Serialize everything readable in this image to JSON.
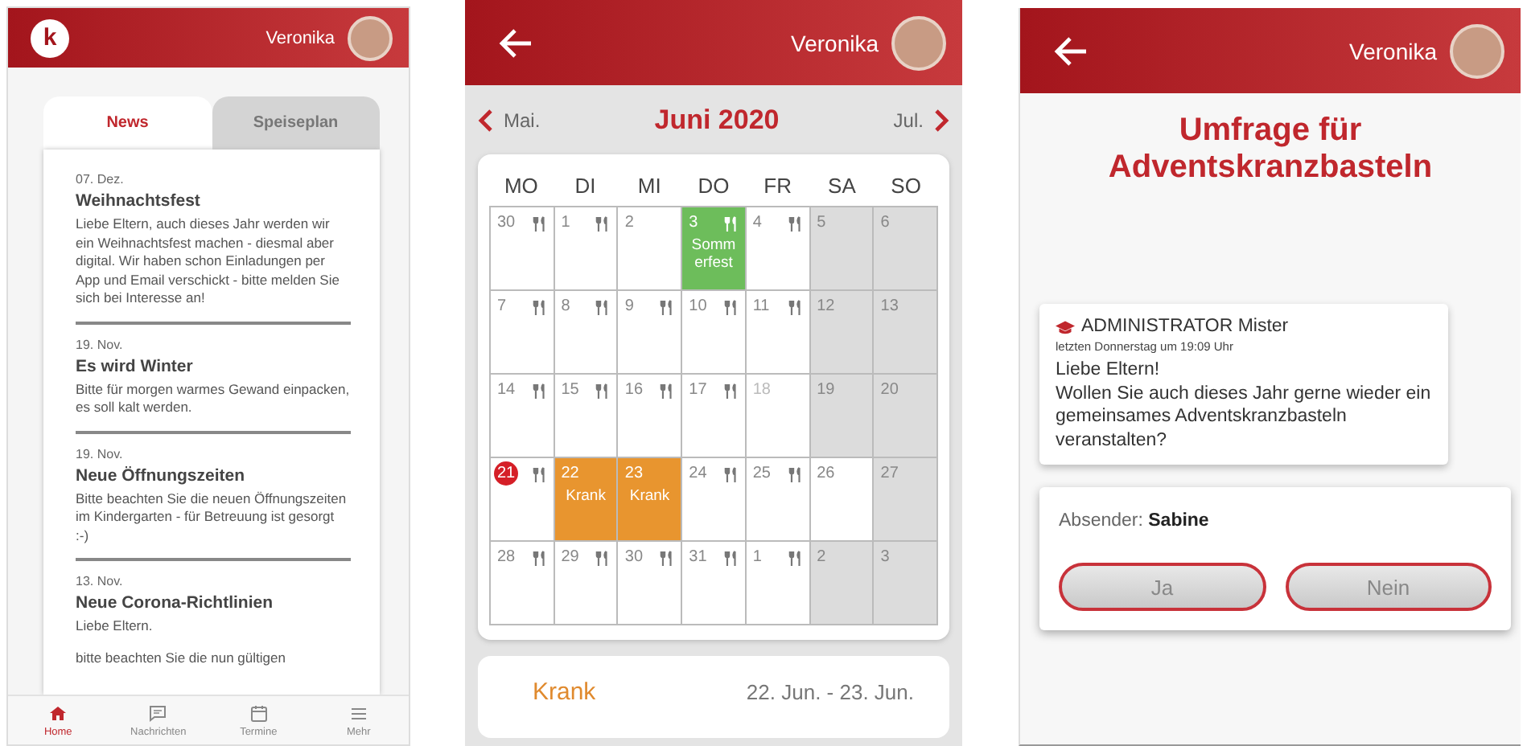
{
  "news_screen": {
    "header": {
      "logo_letter": "k",
      "user": "Veronika"
    },
    "tabs": [
      {
        "label": "News",
        "selected": true
      },
      {
        "label": "Speiseplan",
        "selected": false
      }
    ],
    "news": [
      {
        "date": "07. Dez.",
        "title": "Weihnachtsfest",
        "paragraphs": [
          "Liebe Eltern, auch dieses Jahr werden wir ein Weihnachtsfest machen - diesmal aber digital. Wir haben schon Einladungen per App und Email verschickt - bitte melden Sie sich bei Interesse an!"
        ]
      },
      {
        "date": "19. Nov.",
        "title": "Es wird Winter",
        "paragraphs": [
          "Bitte für morgen warmes Gewand einpacken, es soll kalt werden."
        ]
      },
      {
        "date": "19. Nov.",
        "title": "Neue Öffnungszeiten",
        "paragraphs": [
          "Bitte beachten Sie die neuen Öffnungszeiten im Kindergarten - für Betreuung ist gesorgt :-)"
        ]
      },
      {
        "date": "13. Nov.",
        "title": "Neue Corona-Richtlinien",
        "paragraphs": [
          "Liebe Eltern.",
          "bitte beachten Sie die nun gültigen"
        ]
      }
    ],
    "nav": [
      {
        "label": "Home",
        "kind": "home",
        "selected": true
      },
      {
        "label": "Nachrichten",
        "kind": "chat",
        "selected": false
      },
      {
        "label": "Termine",
        "kind": "calendar",
        "selected": false
      },
      {
        "label": "Mehr",
        "kind": "menu",
        "selected": false
      }
    ]
  },
  "calendar_screen": {
    "header": {
      "user": "Veronika"
    },
    "month_nav": {
      "previous": "Mai.",
      "title": "Juni 2020",
      "next": "Jul."
    },
    "weekdays": [
      "MO",
      "DI",
      "MI",
      "DO",
      "FR",
      "SA",
      "SO"
    ],
    "weeks": [
      [
        {
          "day": "30",
          "kind": "workday",
          "meal": true,
          "today": false,
          "muted": false
        },
        {
          "day": "1",
          "kind": "workday",
          "meal": true,
          "today": false,
          "muted": false
        },
        {
          "day": "2",
          "kind": "workday",
          "meal": false,
          "today": false,
          "muted": false
        },
        {
          "day": "3",
          "kind": "event",
          "meal": true,
          "today": false,
          "muted": false,
          "event": "Sommerfest",
          "color": "#6dbd5b"
        },
        {
          "day": "4",
          "kind": "workday",
          "meal": true,
          "today": false,
          "muted": false
        },
        {
          "day": "5",
          "kind": "weekend",
          "meal": false,
          "today": false,
          "muted": false
        },
        {
          "day": "6",
          "kind": "weekend",
          "meal": false,
          "today": false,
          "muted": false
        }
      ],
      [
        {
          "day": "7",
          "kind": "workday",
          "meal": true,
          "today": false,
          "muted": false
        },
        {
          "day": "8",
          "kind": "workday",
          "meal": true,
          "today": false,
          "muted": false
        },
        {
          "day": "9",
          "kind": "workday",
          "meal": true,
          "today": false,
          "muted": false
        },
        {
          "day": "10",
          "kind": "workday",
          "meal": true,
          "today": false,
          "muted": false
        },
        {
          "day": "11",
          "kind": "workday",
          "meal": true,
          "today": false,
          "muted": false
        },
        {
          "day": "12",
          "kind": "weekend",
          "meal": false,
          "today": false,
          "muted": false
        },
        {
          "day": "13",
          "kind": "weekend",
          "meal": false,
          "today": false,
          "muted": false
        }
      ],
      [
        {
          "day": "14",
          "kind": "workday",
          "meal": true,
          "today": false,
          "muted": false
        },
        {
          "day": "15",
          "kind": "workday",
          "meal": true,
          "today": false,
          "muted": false
        },
        {
          "day": "16",
          "kind": "workday",
          "meal": true,
          "today": false,
          "muted": false
        },
        {
          "day": "17",
          "kind": "workday",
          "meal": true,
          "today": false,
          "muted": false
        },
        {
          "day": "18",
          "kind": "workday",
          "meal": false,
          "today": false,
          "muted": true
        },
        {
          "day": "19",
          "kind": "weekend",
          "meal": false,
          "today": false,
          "muted": false
        },
        {
          "day": "20",
          "kind": "weekend",
          "meal": false,
          "today": false,
          "muted": false
        }
      ],
      [
        {
          "day": "21",
          "kind": "workday",
          "meal": true,
          "today": true,
          "muted": false
        },
        {
          "day": "22",
          "kind": "event",
          "meal": false,
          "today": false,
          "muted": false,
          "event": "Krank",
          "color": "#e8952f"
        },
        {
          "day": "23",
          "kind": "event",
          "meal": false,
          "today": false,
          "muted": false,
          "event": "Krank",
          "color": "#e8952f"
        },
        {
          "day": "24",
          "kind": "workday",
          "meal": true,
          "today": false,
          "muted": false
        },
        {
          "day": "25",
          "kind": "workday",
          "meal": true,
          "today": false,
          "muted": false
        },
        {
          "day": "26",
          "kind": "workday",
          "meal": false,
          "today": false,
          "muted": false
        },
        {
          "day": "27",
          "kind": "weekend",
          "meal": false,
          "today": false,
          "muted": false
        }
      ],
      [
        {
          "day": "28",
          "kind": "workday",
          "meal": true,
          "today": false,
          "muted": false
        },
        {
          "day": "29",
          "kind": "workday",
          "meal": true,
          "today": false,
          "muted": false
        },
        {
          "day": "30",
          "kind": "workday",
          "meal": true,
          "today": false,
          "muted": false
        },
        {
          "day": "31",
          "kind": "workday",
          "meal": true,
          "today": false,
          "muted": false
        },
        {
          "day": "1",
          "kind": "workday",
          "meal": true,
          "today": false,
          "muted": false
        },
        {
          "day": "2",
          "kind": "weekend",
          "meal": false,
          "today": false,
          "muted": false
        },
        {
          "day": "3",
          "kind": "weekend",
          "meal": false,
          "today": false,
          "muted": false
        }
      ]
    ],
    "detail": {
      "title": "Krank",
      "dates": "22. Jun. - 23. Jun."
    }
  },
  "poll_screen": {
    "header": {
      "user": "Veronika"
    },
    "title": "Umfrage für Adventskranzbasteln",
    "message": {
      "author": "ADMINISTRATOR Mister",
      "time": "letzten Donnerstag um 19:09 Uhr",
      "greeting": "Liebe Eltern!",
      "text": "Wollen Sie auch dieses Jahr gerne wieder ein gemeinsames Adventskranzbasteln veranstalten?"
    },
    "sender": "Absender: **Sabine**",
    "buttons": [
      "Ja",
      "Nein"
    ]
  }
}
